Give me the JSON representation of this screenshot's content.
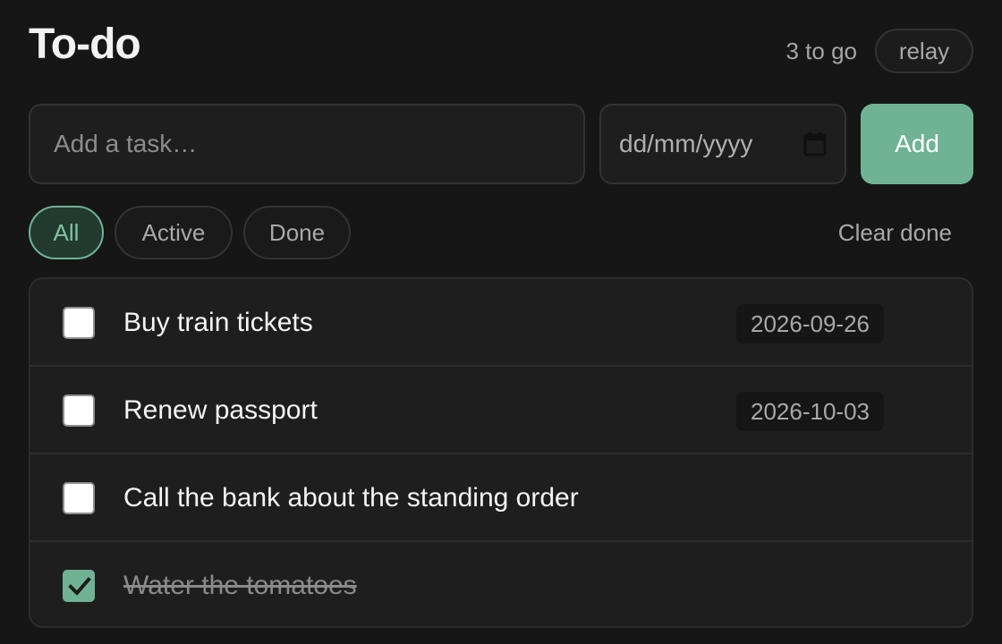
{
  "header": {
    "title": "To-do",
    "remaining": "3 to go",
    "badge": "relay"
  },
  "add_form": {
    "task_placeholder": "Add a task…",
    "task_value": "",
    "date_placeholder": "dd/mm/yyyy",
    "add_label": "Add"
  },
  "filters": {
    "items": [
      {
        "label": "All",
        "active": true
      },
      {
        "label": "Active",
        "active": false
      },
      {
        "label": "Done",
        "active": false
      }
    ],
    "clear_label": "Clear done"
  },
  "tasks": [
    {
      "label": "Buy train tickets",
      "due": "2026-09-26",
      "done": false
    },
    {
      "label": "Renew passport",
      "due": "2026-10-03",
      "done": false
    },
    {
      "label": "Call the bank about the standing order",
      "due": "",
      "done": false
    },
    {
      "label": "Water the tomatoes",
      "due": "",
      "done": true
    }
  ],
  "icons": {
    "date": "calendar-icon",
    "checked": "check-icon"
  },
  "colors": {
    "accent": "#6fb394",
    "background": "#161616",
    "surface": "#1e1e1e"
  }
}
